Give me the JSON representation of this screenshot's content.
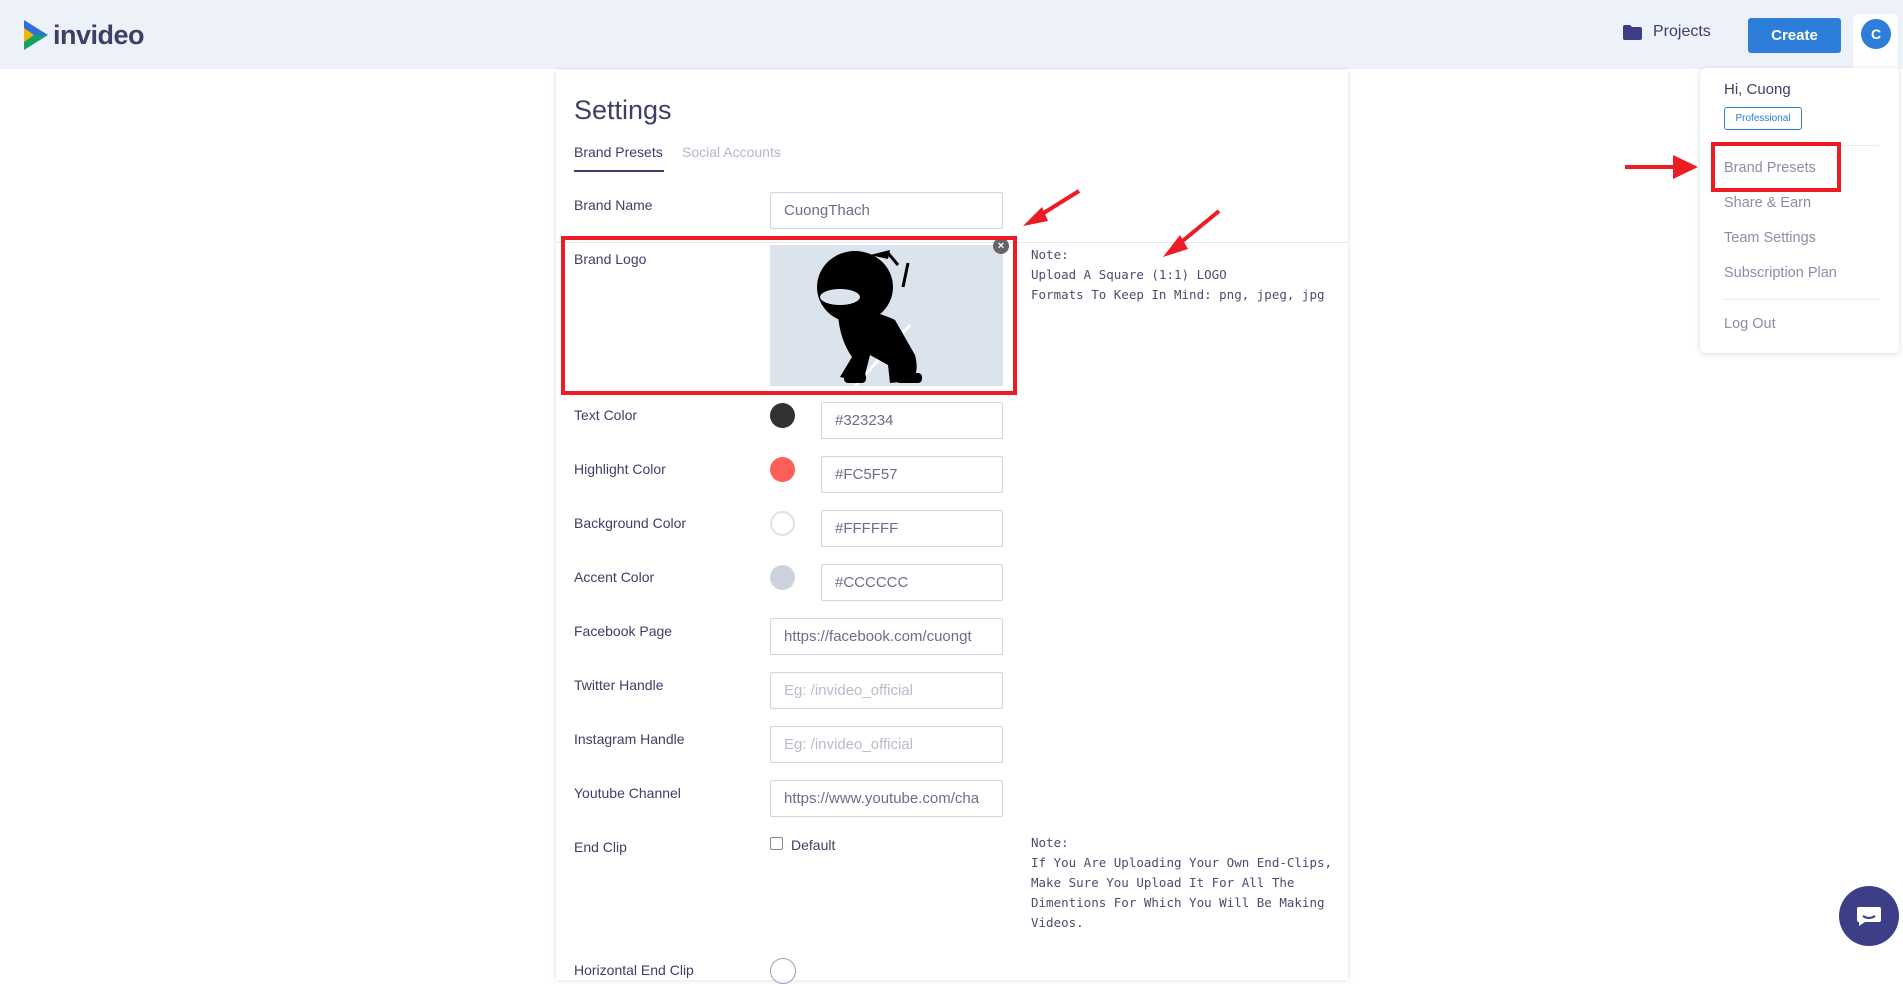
{
  "brand": {
    "name": "invideo"
  },
  "header": {
    "projects_label": "Projects",
    "create_label": "Create",
    "avatar_initial": "C",
    "accent_color": "#2d7ed8"
  },
  "settings": {
    "title": "Settings",
    "tabs": [
      {
        "label": "Brand Presets",
        "active": true
      },
      {
        "label": "Social Accounts",
        "active": false
      }
    ],
    "fields": {
      "brand_name": {
        "label": "Brand Name",
        "value": "CuongThach"
      },
      "brand_logo": {
        "label": "Brand Logo"
      },
      "text_color": {
        "label": "Text Color",
        "value": "#323234"
      },
      "highlight_color": {
        "label": "Highlight Color",
        "value": "#FC5F57"
      },
      "background_color": {
        "label": "Background Color",
        "value": "#FFFFFF"
      },
      "accent_color": {
        "label": "Accent Color",
        "value": "#CCCCCC"
      },
      "facebook_page": {
        "label": "Facebook Page",
        "value": "https://facebook.com/cuongt"
      },
      "twitter_handle": {
        "label": "Twitter Handle",
        "placeholder": "Eg: /invideo_official"
      },
      "instagram_handle": {
        "label": "Instagram Handle",
        "placeholder": "Eg: /invideo_official"
      },
      "youtube_channel": {
        "label": "Youtube Channel",
        "value": "https://www.youtube.com/cha"
      },
      "end_clip": {
        "label": "End Clip",
        "checkbox_label": "Default"
      },
      "horizontal_end_clip": {
        "label": "Horizontal End Clip"
      }
    },
    "logo_note": {
      "line1": "Note:",
      "line2": "Upload A Square (1:1) LOGO",
      "line3": "Formats To Keep In Mind: png, jpeg, jpg"
    },
    "end_clip_note": {
      "line1": "Note:",
      "line2": "If You Are Uploading Your Own End-Clips,",
      "line3": "Make Sure You Upload It For All The",
      "line4": "Dimentions For Which You Will Be Making",
      "line5": "Videos."
    }
  },
  "user_menu": {
    "greeting": "Hi, Cuong",
    "plan_badge": "Professional",
    "items": [
      {
        "label": "Brand Presets"
      },
      {
        "label": "Share & Earn"
      },
      {
        "label": "Team Settings"
      },
      {
        "label": "Subscription Plan"
      },
      {
        "label": "Log Out"
      }
    ]
  },
  "annotations": {
    "color": "#ec1c24"
  }
}
